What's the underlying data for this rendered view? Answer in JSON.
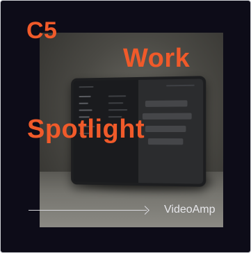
{
  "card": {
    "badge": "C5",
    "headline_line1": "Work",
    "headline_line2": "Spotlight",
    "client_name": "VideoAmp",
    "accent_color": "#f05a2a",
    "background_color": "#0d0c18"
  },
  "image": {
    "subject": "tablet-device-photo"
  },
  "icons": {
    "arrow": "arrow-right-icon"
  }
}
